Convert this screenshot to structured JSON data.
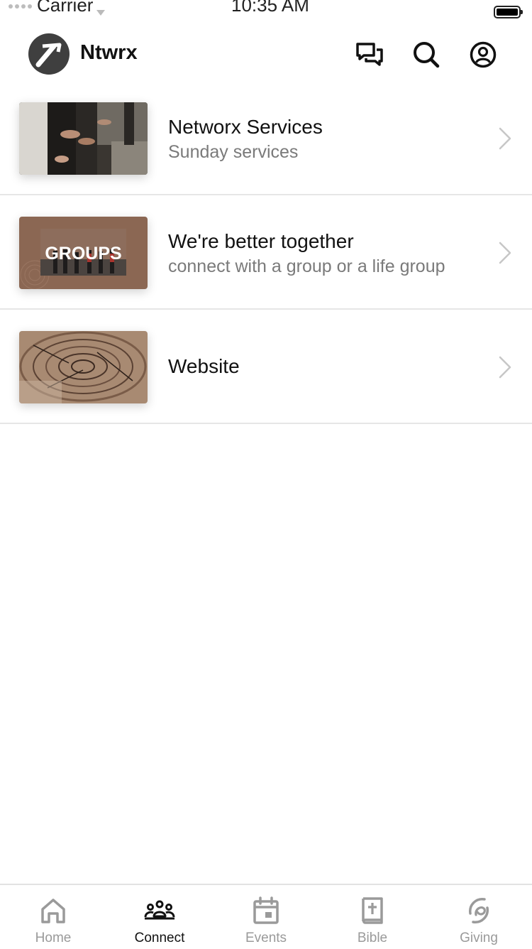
{
  "status_bar": {
    "carrier": "Carrier",
    "time": "10:35 AM"
  },
  "header": {
    "title": "Ntwrx",
    "icons": [
      "chat-icon",
      "search-icon",
      "profile-icon"
    ]
  },
  "rows": [
    {
      "title": "Networx Services",
      "subtitle": "Sunday services"
    },
    {
      "title": "We're better together",
      "subtitle": "connect with a group or a life group",
      "thumb_text": "GROUPS"
    },
    {
      "title": "Website",
      "subtitle": ""
    }
  ],
  "tabs": [
    {
      "label": "Home",
      "icon": "home-icon"
    },
    {
      "label": "Connect",
      "icon": "people-icon",
      "active": true
    },
    {
      "label": "Events",
      "icon": "calendar-icon"
    },
    {
      "label": "Bible",
      "icon": "bible-icon"
    },
    {
      "label": "Giving",
      "icon": "giving-icon"
    }
  ],
  "colors": {
    "active": "#111111",
    "inactive": "#9a9a9a",
    "divider": "#e6e6e6",
    "subtitle": "#7a7a7a"
  }
}
